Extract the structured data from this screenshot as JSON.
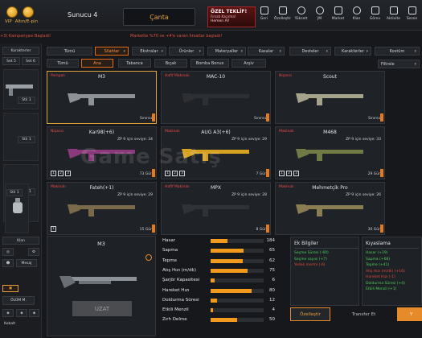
{
  "topbar": {
    "vip_label": "VIP",
    "altin_label": "Altın/E-pin",
    "server": "Sunucu 4",
    "cart": "Çanta",
    "offer": {
      "title": "ÖZEL TEKLİF!",
      "subtitle": "Fırsatı Kaçırma!",
      "cta": "Hemen Al!"
    },
    "nav": [
      {
        "label": "Geri",
        "icon": "back-icon"
      },
      {
        "label": "Özelleştir",
        "icon": "customize-icon"
      },
      {
        "label": "Yükselt",
        "icon": "upgrade-icon"
      },
      {
        "label": "JM",
        "icon": "jm-icon"
      },
      {
        "label": "Market",
        "icon": "market-icon"
      },
      {
        "label": "Klan",
        "icon": "clan-icon"
      },
      {
        "label": "Görev",
        "icon": "mission-icon"
      },
      {
        "label": "Aktivite",
        "icon": "activity-icon"
      },
      {
        "label": "Sezon",
        "icon": "season-icon"
      }
    ]
  },
  "marquee": {
    "left": "+3) Kampanyası Başladı!",
    "right": "Markette %70 ve +4'e varan fırsatlar başladı!"
  },
  "left_panel": {
    "karakterler": "Karakterler",
    "set5": "Set 5",
    "set6": "Set 6",
    "stil1": "Stil 1",
    "stil1b": "Stil 1",
    "stil1c": "Stil 1",
    "stil1d": "Stil 1",
    "klan": "Klan",
    "mesaj": "Mesaj",
    "olum": "ÖLÜM M.",
    "kobalt": "Kobalt"
  },
  "filters_row1": [
    {
      "label": "Tümü",
      "active": false
    },
    {
      "label": "Silahlar",
      "active": true
    },
    {
      "label": "Ekstralar",
      "active": false
    },
    {
      "label": "Ürünler",
      "active": false
    },
    {
      "label": "Materyaller",
      "active": false
    },
    {
      "label": "Kasalar",
      "active": false
    },
    {
      "label": "Desteler",
      "active": false
    },
    {
      "label": "Karakterler",
      "active": false
    },
    {
      "label": "Kostüm",
      "active": false
    }
  ],
  "filters_row2": [
    {
      "label": "Tümü",
      "active": false
    },
    {
      "label": "Ana",
      "active": true
    },
    {
      "label": "Tabanca",
      "active": false
    },
    {
      "label": "Bıçak",
      "active": false
    },
    {
      "label": "Bomba Bonus",
      "active": false
    },
    {
      "label": "Arşiv",
      "active": false
    }
  ],
  "filter_select": "Filtrele",
  "cards": [
    {
      "category": "Pompalı",
      "name": "M3",
      "level": "",
      "duration": "Sınırsız",
      "selected": true,
      "slots": []
    },
    {
      "category": "Hafif Makinalı",
      "name": "MAC-10",
      "level": "",
      "duration": "Sınırsız",
      "selected": false,
      "slots": []
    },
    {
      "category": "Nişancı",
      "name": "Scout",
      "level": "",
      "duration": "Sınırsız",
      "selected": false,
      "slots": []
    },
    {
      "category": "Nişancı",
      "name": "Kar98(+6)",
      "level": "ZP 9 için seviye: 34",
      "duration": "73 Gün",
      "selected": false,
      "slots": [
        "1",
        "2",
        "3"
      ]
    },
    {
      "category": "Makinalı",
      "name": "AUG A3(+6)",
      "level": "ZP 9 için seviye: 29",
      "duration": "7 Gün",
      "selected": false,
      "slots": [
        "1",
        "2",
        "3"
      ]
    },
    {
      "category": "Makinalı",
      "name": "M468",
      "level": "ZP 9 için seviye: 33",
      "duration": "29 Gün",
      "selected": false,
      "slots": [
        "1",
        "2",
        "3"
      ]
    },
    {
      "category": "Makinalı",
      "name": "Fateh(+1)",
      "level": "ZP 9 için seviye: 29",
      "duration": "15 Gün",
      "selected": false,
      "slots": [
        "1"
      ]
    },
    {
      "category": "Hafif Makinalı",
      "name": "MPX",
      "level": "ZP 9 için seviye: 28",
      "duration": "8 Gün",
      "selected": false,
      "slots": []
    },
    {
      "category": "Makinalı",
      "name": "Mehmetçik Pro",
      "level": "ZP 9 için seviye: 26",
      "duration": "30 Gün",
      "selected": false,
      "slots": []
    }
  ],
  "watermark": "Game Satış",
  "detail": {
    "title": "M3",
    "button": "UZAT"
  },
  "stats": [
    {
      "name": "Hasar",
      "value": 184,
      "fill": 0.32
    },
    {
      "name": "Sapma",
      "value": 65,
      "fill": 0.62
    },
    {
      "name": "Tepme",
      "value": 62,
      "fill": 0.6
    },
    {
      "name": "Atış Hızı (m/dk)",
      "value": 75,
      "fill": 0.7
    },
    {
      "name": "Şarjör Kapasitesi",
      "value": 6,
      "fill": 0.08
    },
    {
      "name": "Hareket Hızı",
      "value": 80,
      "fill": 0.78
    },
    {
      "name": "Doldurma Süresi",
      "value": 12,
      "fill": 0.12
    },
    {
      "name": "Etkili Menzil",
      "value": 4,
      "fill": 0.05
    },
    {
      "name": "Zırh Delme",
      "value": 50,
      "fill": 0.5
    }
  ],
  "ek_bilgiler": {
    "title": "Ek Bilgiler",
    "lines": [
      {
        "text": "Seçme Süresi (-60)",
        "color": "#4fcf5a"
      },
      {
        "text": "Seçme sayısı (+7)",
        "color": "#4fcf5a"
      },
      {
        "text": "Yedek mermi (-6)",
        "color": "#e04a3a"
      }
    ]
  },
  "kiyaslama": {
    "title": "Kıyaslama",
    "lines": [
      {
        "text": "Hasar (+19)",
        "color": "#4fcf5a"
      },
      {
        "text": "Sapma (+68)",
        "color": "#4fcf5a"
      },
      {
        "text": "Tepme (+41)",
        "color": "#4fcf5a"
      },
      {
        "text": "Atış Hızı (m/dk) (+16)",
        "color": "#e04a3a"
      },
      {
        "text": "Hareket Hızı (-1)",
        "color": "#e04a3a"
      },
      {
        "text": "Doldurma Süresi (+4)",
        "color": "#4fcf5a"
      },
      {
        "text": "Etkili Menzil (+1)",
        "color": "#4fcf5a"
      }
    ]
  },
  "actions": {
    "ozellestir": "Özelleştir",
    "transfer": "Transfer Et",
    "y": "Y"
  }
}
